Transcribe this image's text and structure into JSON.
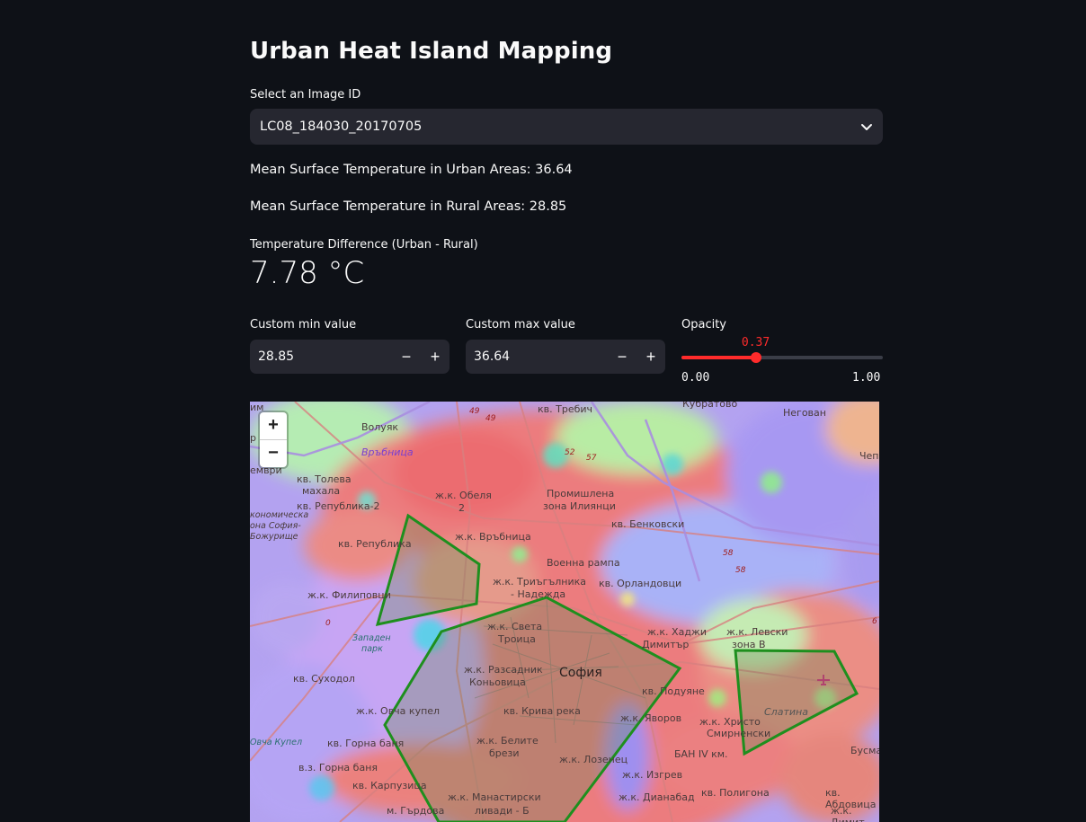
{
  "title": "Urban Heat Island Mapping",
  "select": {
    "label": "Select an Image ID",
    "value": "LC08_184030_20170705",
    "chevron_icon": "chevron-down-icon"
  },
  "stats": {
    "urban": "Mean Surface Temperature in Urban Areas: 36.64",
    "rural": "Mean Surface Temperature in Rural Areas: 28.85"
  },
  "metric": {
    "label": "Temperature Difference (Urban - Rural)",
    "value": "7.78 °C"
  },
  "min_input": {
    "label": "Custom min value",
    "value": "28.85",
    "minus": "−",
    "plus": "+"
  },
  "max_input": {
    "label": "Custom max value",
    "value": "36.64",
    "minus": "−",
    "plus": "+"
  },
  "opacity": {
    "label": "Opacity",
    "value": 0.37,
    "value_text": "0.37",
    "min_text": "0.00",
    "max_text": "1.00",
    "accent": "#ff2b2b"
  },
  "map": {
    "zoom_in": "+",
    "zoom_out": "−",
    "labels": {
      "trebich": "кв. Требич",
      "kubratovo": "Кубратово",
      "negovan": "Негован",
      "voluyak": "Волуяк",
      "vrabnitsa": "Връбница",
      "chepintsi": "Чепинци",
      "tsemevri": "ември",
      "toleva": "кв. Толева",
      "mahala": "махала",
      "obelya": "ж.к. Обеля",
      "obelya2": "2",
      "promishlena": "Промишлена",
      "iliyantsi": "зона Илиянци",
      "republika2": "кв. Република-2",
      "ikonom": "кономическа",
      "zona_sofia": "она София-",
      "bozhurishte": "Божурище",
      "benkovski": "кв. Бенковски",
      "republika": "кв. Република",
      "vrabnitsa_jk": "ж.к. Връбница",
      "voenna": "Военна рампа",
      "triagalnika": "ж.к. Триъгълника",
      "nadezhda": "- Надежда",
      "filipovtsi": "ж.к. Филиповци",
      "orlandovtsi": "кв. Орландовци",
      "sveta": "ж.к. Света",
      "troitsa": "Троица",
      "hadzhi": "ж.к. Хаджи",
      "dimitar": "Димитър",
      "levski": "ж.к. Левски",
      "zona_v": "зона В",
      "zapaden": "Западен",
      "park": "парк",
      "razsadnik": "ж.к. Разсадник",
      "konyovitsa": "Коньовица",
      "sofia": "София",
      "suhodol": "кв. Суходол",
      "poduyane": "кв. Подуяне",
      "ovcha_kupel": "ж.к. Овча купел",
      "kriva": "кв. Крива река",
      "yavorov": "ж.к. Яворов",
      "hristo": "ж.к. Христо",
      "smirnenski": "Смирненски",
      "slatina": "Слатина",
      "ovcha_park": "Овча Купел",
      "gorna_banya": "кв. Горна баня",
      "belite": "ж.к. Белите",
      "brezi": "брези",
      "ban": "БАН IV км.",
      "busman": "Бусма",
      "vz_gorna": "в.з. Горна баня",
      "lozenets": "ж.к. Лозенец",
      "izgrev": "ж.к. Изгрев",
      "karpuzitsa": "кв. Карпузица",
      "manastirski": "ж.к. Манастирски",
      "livadi": "ливади - Б",
      "dianabad": "ж.к. Дианабад",
      "poligona": "кв. Полигона",
      "abdovitsa": "кв. Абдовица",
      "gardova": "м. Гърдова",
      "dimitar2": "ж.к. Димит",
      "r49": "49",
      "r49b": "49",
      "r52": "52",
      "r57": "57",
      "r58": "58",
      "r58b": "58",
      "r0": "0",
      "r6": "6",
      "r_m": "им",
      "r_p": "р"
    },
    "airport_icon": "airplane-icon"
  }
}
